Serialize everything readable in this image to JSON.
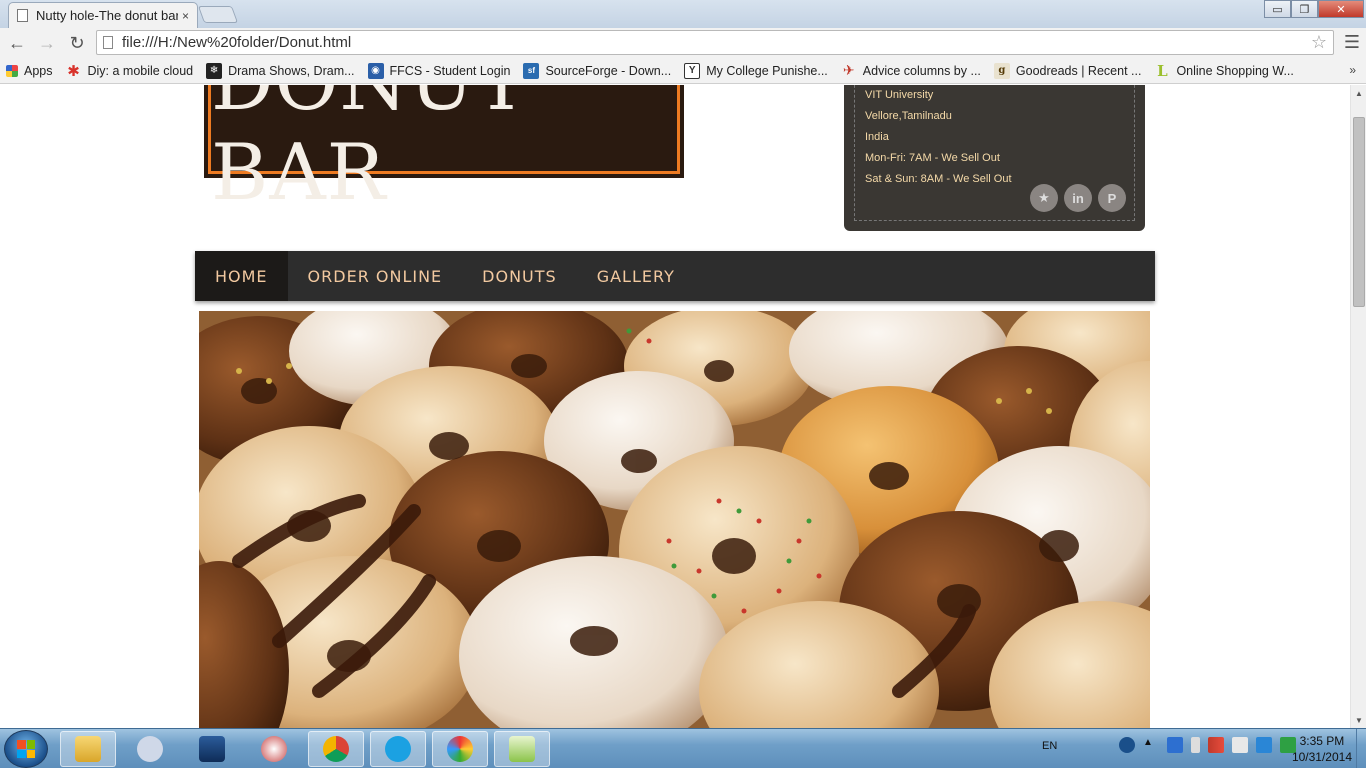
{
  "browser": {
    "tab_title": "Nutty hole-The donut bar",
    "tab_close": "×",
    "url": "file:///H:/New%20folder/Donut.html",
    "window_buttons": [
      "▭",
      "❐",
      "✕"
    ]
  },
  "bookmarks": [
    {
      "label": "Apps",
      "icon": "apps-grid-icon",
      "color": "#d44"
    },
    {
      "label": "Diy: a mobile cloud",
      "icon": "red-asterisk-icon",
      "color": "#d8322b"
    },
    {
      "label": "Drama Shows, Dram...",
      "icon": "snowflake-icon",
      "color": "#222"
    },
    {
      "label": "FFCS - Student Login",
      "icon": "ffcs-icon",
      "color": "#2b5fa8"
    },
    {
      "label": "SourceForge - Down...",
      "icon": "sourceforge-icon",
      "color": "#2b6cb0"
    },
    {
      "label": "My College Punishe...",
      "icon": "y-icon",
      "color": "#ffffff"
    },
    {
      "label": "Advice columns by ...",
      "icon": "advice-icon",
      "color": "#c0392b"
    },
    {
      "label": "Goodreads | Recent ...",
      "icon": "goodreads-icon",
      "color": "#e9e2cf"
    },
    {
      "label": "Online Shopping W...",
      "icon": "l-leaf-icon",
      "color": "#9bbf2d"
    }
  ],
  "bookmarks_more": "»",
  "site": {
    "logo_text": "DONUT BAR",
    "address_lines": [
      "VIT University",
      "Vellore,Tamilnadu",
      "India",
      "Mon-Fri: 7AM - We Sell Out",
      "Sat & Sun: 8AM - We Sell Out"
    ],
    "social": [
      {
        "name": "star",
        "glyph": "★"
      },
      {
        "name": "linkedin",
        "glyph": "in"
      },
      {
        "name": "pinterest",
        "glyph": "P"
      }
    ],
    "nav": [
      "HOME",
      "ORDER ONLINE",
      "DONUTS",
      "GALLERY"
    ],
    "accent": "#f2c9a0",
    "logo_border_color": "#ee7b22"
  },
  "taskbar": {
    "language": "EN",
    "time": "3:35 PM",
    "date": "10/31/2014"
  }
}
